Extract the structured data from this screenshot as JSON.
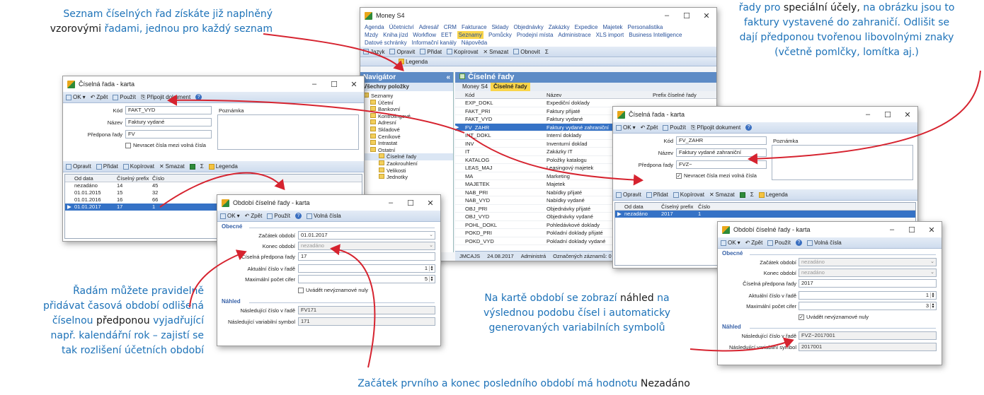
{
  "annotations": {
    "a1": {
      "p1": "Seznam číselných řad získáte již naplněný",
      "p2a": "vzorovými",
      "p2b": " řadami, ",
      "p2c": "jednou pro každý seznam"
    },
    "a2": {
      "p1a": "řady pro ",
      "p1b": "speciální účely,",
      "p1c": " na obrázku jsou to",
      "p2": "faktury vystavené do zahraničí. Odlišit se",
      "p3": "dají předponou tvořenou libovolnými znaky",
      "p4": "(včetně pomlčky, lomítka aj.)"
    },
    "a3": {
      "p1": "Řadám můžete pravidelně",
      "p2": "přidávat časová období odlišená",
      "p3a": "číselnou ",
      "p3b": "předponou",
      "p3c": " vyjadřující",
      "p4": "např. kalendářní rok – zajistí se",
      "p5": "tak rozlišení účetních období"
    },
    "a4": {
      "p1a": "Na kartě období se zobrazí ",
      "p1b": "náhled",
      "p1c": " na",
      "p2": "výslednou podobu čísel i automaticky",
      "p3": "generovaných variabilních symbolů"
    },
    "a5": {
      "p1a": "Začátek prvního a konec posledního období má hodnotu ",
      "p1b": "Nezadáno"
    }
  },
  "main": {
    "title": "Money S4",
    "menu1": [
      "Agenda",
      "Účetnictví",
      "Adresář",
      "CRM",
      "Fakturace",
      "Sklady",
      "Objednávky",
      "Zakázky",
      "Expedice",
      "Majetek",
      "Personalistika"
    ],
    "menu2": [
      "Mzdy",
      "Kniha jízd",
      "Workflow",
      "EET",
      "Seznamy",
      "Pomůcky",
      "Prodejní místa",
      "Administrace",
      "XLS import",
      "Business Intelligence"
    ],
    "menu3": [
      "Datové schránky",
      "Informační kanály",
      "Nápověda"
    ],
    "toolbar": {
      "jazyk": "Jazyk",
      "opravit": "Opravit",
      "pridat": "Přidat",
      "kopirovat": "Kopírovat",
      "smazat": "Smazat",
      "obnovit": "Obnovit",
      "legenda": "Legenda",
      "sigma": "Σ"
    },
    "navigator": {
      "title": "Navigátor",
      "all": "Všechny položky",
      "items": [
        "Seznamy",
        "Účetní",
        "Bankovní",
        "Kontrolingové",
        "Adresní",
        "Skladové",
        "Ceníkové",
        "Intrastat",
        "Ostatní",
        "Číselné řady",
        "Zaokrouhlení",
        "Velikosti",
        "Jednotky"
      ]
    },
    "panel_title": "Číselné řady",
    "tabs": [
      "Money S4",
      "Číselné řady"
    ],
    "cols": {
      "kod": "Kód",
      "nazev": "Název",
      "prefix": "Prefix číselné řady"
    },
    "rows": [
      {
        "kod": "EXP_DOKL",
        "nazev": "Expediční doklady"
      },
      {
        "kod": "FAKT_PRI",
        "nazev": "Faktury přijaté"
      },
      {
        "kod": "FAKT_VYD",
        "nazev": "Faktury vydané"
      },
      {
        "kod": "FV_ZAHR",
        "nazev": "Faktury vydané zahraniční"
      },
      {
        "kod": "INT_DOKL",
        "nazev": "Interní doklady"
      },
      {
        "kod": "INV",
        "nazev": "Inventurní doklad"
      },
      {
        "kod": "IT",
        "nazev": "Zakázky IT"
      },
      {
        "kod": "KATALOG",
        "nazev": "Položky katalogu"
      },
      {
        "kod": "LEAS_MAJ",
        "nazev": "Leasingový majetek"
      },
      {
        "kod": "MA",
        "nazev": "Marketing"
      },
      {
        "kod": "MAJETEK",
        "nazev": "Majetek"
      },
      {
        "kod": "NAB_PRI",
        "nazev": "Nabídky přijaté"
      },
      {
        "kod": "NAB_VYD",
        "nazev": "Nabídky vydané"
      },
      {
        "kod": "OBJ_PRI",
        "nazev": "Objednávky přijaté"
      },
      {
        "kod": "OBJ_VYD",
        "nazev": "Objednávky vydané"
      },
      {
        "kod": "POHL_DOKL",
        "nazev": "Pohledávkové doklady"
      },
      {
        "kod": "POKD_PRI",
        "nazev": "Pokladní doklady přijaté"
      },
      {
        "kod": "POKD_VYD",
        "nazev": "Pokladní doklady vydané"
      }
    ],
    "status": {
      "user": "JMCAJS",
      "date": "24.08.2017",
      "admin": "Administrá",
      "marked": "Označených záznamů: 0"
    }
  },
  "card1": {
    "title": "Číselná řada - karta",
    "tb": {
      "ok": "OK",
      "zpet": "Zpět",
      "pouzit": "Použít",
      "pripojit": "Připojit dokument"
    },
    "kod_l": "Kód",
    "kod": "FAKT_VYD",
    "nazev_l": "Název",
    "nazev": "Faktury vydané",
    "pred_l": "Předpona řady",
    "pred": "FV",
    "chk": "Nevracet čísla mezi volná čísla",
    "pozn": "Poznámka",
    "tb2": {
      "opravit": "Opravit",
      "pridat": "Přidat",
      "kopirovat": "Kopírovat",
      "smazat": "Smazat",
      "legenda": "Legenda",
      "sigma": "Σ"
    },
    "cols": [
      "Od data",
      "Číselný prefix",
      "Číslo"
    ],
    "rows": [
      [
        "nezadáno",
        "14",
        "45"
      ],
      [
        "01.01.2015",
        "15",
        "32"
      ],
      [
        "01.01.2016",
        "16",
        "66"
      ],
      [
        "01.01.2017",
        "17",
        "1"
      ]
    ]
  },
  "card2": {
    "title": "Číselná řada - karta",
    "tb": {
      "ok": "OK",
      "zpet": "Zpět",
      "pouzit": "Použít",
      "pripojit": "Připojit dokument"
    },
    "kod_l": "Kód",
    "kod": "FV_ZAHR",
    "nazev_l": "Název",
    "nazev": "Faktury vydané zahraniční",
    "pred_l": "Předpona řady",
    "pred": "FVZ−",
    "chk": "Nevracet čísla mezi volná čísla",
    "pozn": "Poznámka",
    "tb2": {
      "opravit": "Opravit",
      "pridat": "Přidat",
      "kopirovat": "Kopírovat",
      "smazat": "Smazat",
      "legenda": "Legenda",
      "sigma": "Σ"
    },
    "cols": [
      "Od data",
      "Číselný prefix",
      "Číslo"
    ],
    "rows": [
      [
        "nezadáno",
        "2017",
        "1"
      ]
    ]
  },
  "obd1": {
    "title": "Období číselné řady - karta",
    "tb": {
      "ok": "OK",
      "zpet": "Zpět",
      "pouzit": "Použít",
      "volna": "Volná čísla"
    },
    "obecne": "Obecné",
    "zac_l": "Začátek období",
    "zac": "01.01.2017",
    "kon_l": "Konec období",
    "kon": "nezadáno",
    "pref_l": "Číselná předpona řady",
    "pref": "17",
    "akt_l": "Aktuální číslo v řadě",
    "akt": "1",
    "max_l": "Maximální počet cifer",
    "max": "5",
    "nuly": "Uvádět nevýznamové nuly",
    "nahled": "Náhled",
    "nasl_l": "Následující číslo v řadě",
    "nasl": "FV171",
    "vs_l": "Následující variabilní symbol",
    "vs": "171"
  },
  "obd2": {
    "title": "Období číselné řady - karta",
    "tb": {
      "ok": "OK",
      "zpet": "Zpět",
      "pouzit": "Použít",
      "volna": "Volná čísla"
    },
    "obecne": "Obecné",
    "zac_l": "Začátek období",
    "zac": "nezadáno",
    "kon_l": "Konec období",
    "kon": "nezadáno",
    "pref_l": "Číselná předpona řady",
    "pref": "2017",
    "akt_l": "Aktuální číslo v řadě",
    "akt": "1",
    "max_l": "Maximální počet cifer",
    "max": "3",
    "nuly": "Uvádět nevýznamové nuly",
    "nahled": "Náhled",
    "nasl_l": "Následující číslo v řadě",
    "nasl": "FVZ−2017001",
    "vs_l": "Následující variabilní symbol",
    "vs": "2017001"
  }
}
